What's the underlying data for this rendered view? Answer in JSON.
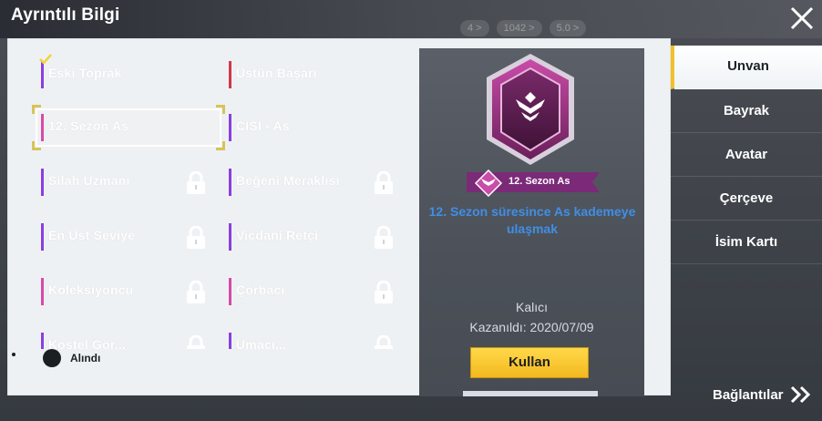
{
  "header": {
    "title": "Ayrıntılı Bilgi",
    "bg_stats": [
      "4 >",
      "1042 >",
      "5.0 >"
    ]
  },
  "titles": [
    {
      "label": "Eski Toprak",
      "color": "violet",
      "checked": true,
      "locked": false
    },
    {
      "label": "Üstün Başarı",
      "color": "red",
      "checked": false,
      "locked": false
    },
    {
      "label": "12. Sezon As",
      "color": "pink",
      "checked": false,
      "locked": false,
      "selected": true
    },
    {
      "label": "CISI - As",
      "color": "violet",
      "checked": false,
      "locked": false
    },
    {
      "label": "Silah Uzmanı",
      "color": "violet",
      "checked": false,
      "locked": true
    },
    {
      "label": "Beğeni Meraklısı",
      "color": "violet",
      "checked": false,
      "locked": true
    },
    {
      "label": "En Üst Seviye",
      "color": "violet",
      "checked": false,
      "locked": true
    },
    {
      "label": "Vicdani Retçi",
      "color": "violet",
      "checked": false,
      "locked": true
    },
    {
      "label": "Koleksiyoncu",
      "color": "pink",
      "checked": false,
      "locked": true
    },
    {
      "label": "Çorbacı",
      "color": "pink",
      "checked": false,
      "locked": true
    },
    {
      "label": "Kostel Gör...",
      "color": "violet",
      "checked": false,
      "locked": true
    },
    {
      "label": "Umacı...",
      "color": "violet",
      "checked": false,
      "locked": true
    }
  ],
  "legend": {
    "label": "Alındı"
  },
  "detail": {
    "ribbon_label": "12. Sezon As",
    "description": "12. Sezon süresince As kademeye ulaşmak",
    "duration": "Kalıcı",
    "earned": "Kazanıldı: 2020/07/09",
    "use_button": "Kullan"
  },
  "tabs": [
    {
      "label": "Unvan",
      "active": true
    },
    {
      "label": "Bayrak",
      "active": false
    },
    {
      "label": "Avatar",
      "active": false
    },
    {
      "label": "Çerçeve",
      "active": false
    },
    {
      "label": "İsim Kartı",
      "active": false
    }
  ],
  "footer": {
    "links_label": "Bağlantılar"
  },
  "colors": {
    "accent": "#f1c02a",
    "description": "#3f8fe6",
    "badge": "#a0307f"
  },
  "icons": [
    "close-icon",
    "lock-icon",
    "check-icon",
    "badge-icon",
    "chevron-right-icon"
  ]
}
